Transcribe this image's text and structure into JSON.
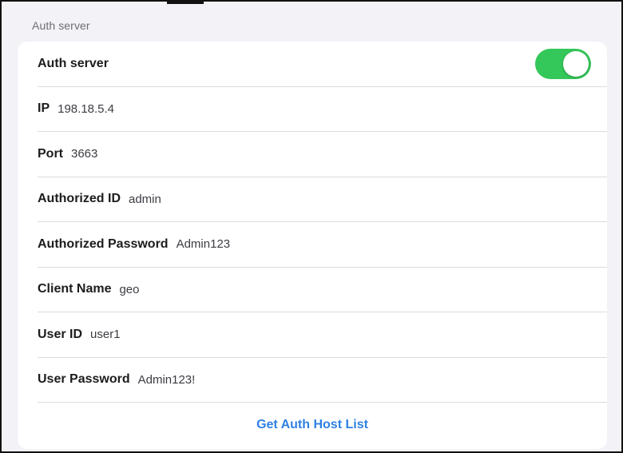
{
  "section": {
    "header": "Auth server"
  },
  "toggle_row": {
    "label": "Auth server",
    "enabled": true,
    "on_color": "#34c759"
  },
  "fields": [
    {
      "label": "IP",
      "value": "198.18.5.4"
    },
    {
      "label": "Port",
      "value": "3663"
    },
    {
      "label": "Authorized ID",
      "value": "admin"
    },
    {
      "label": "Authorized Password",
      "value": "Admin123"
    },
    {
      "label": "Client Name",
      "value": "geo"
    },
    {
      "label": "User ID",
      "value": "user1"
    },
    {
      "label": "User Password",
      "value": "Admin123!"
    }
  ],
  "action": {
    "label": "Get Auth Host List",
    "color": "#2f80e3"
  }
}
